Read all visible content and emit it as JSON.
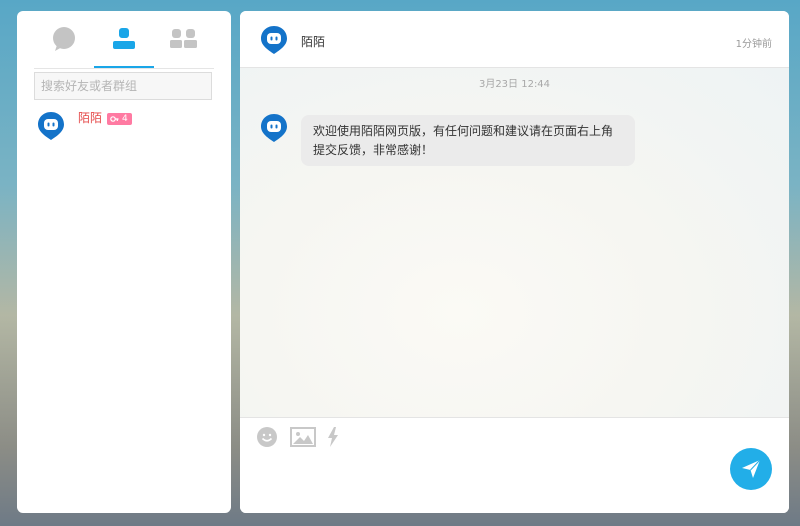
{
  "sidebar": {
    "tabs": [
      {
        "icon": "chat-bubble-icon",
        "active": false
      },
      {
        "icon": "user-icon",
        "active": true
      },
      {
        "icon": "group-icon",
        "active": false
      }
    ],
    "search": {
      "placeholder": "搜索好友或者群组"
    },
    "contacts": [
      {
        "name": "陌陌",
        "badge_icon": "key-icon",
        "badge_count": "4"
      }
    ]
  },
  "chat": {
    "header": {
      "title": "陌陌",
      "time": "1分钟前"
    },
    "date_separator": "3月23日 12:44",
    "messages": [
      {
        "sender": "陌陌",
        "text": "欢迎使用陌陌网页版，有任何问题和建议请在页面右上角提交反馈，非常感谢！"
      }
    ]
  },
  "composer": {
    "tools": [
      "emoji-icon",
      "image-icon",
      "lightning-icon"
    ],
    "send_icon": "paper-plane-icon"
  },
  "colors": {
    "accent": "#1aa6e8",
    "name_red": "#e54848",
    "badge_pink": "#ff7aa2",
    "avatar_blue": "#1473c9"
  }
}
